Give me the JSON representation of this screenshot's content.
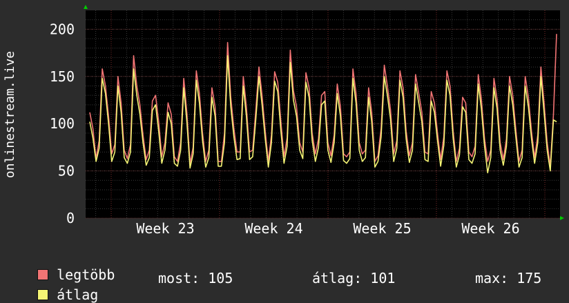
{
  "chart_data": {
    "type": "line",
    "ylabel": "onlinestream.live",
    "ylim": [
      0,
      220
    ],
    "yticks": [
      0,
      50,
      100,
      150,
      200
    ],
    "ytick_labels": [
      "0",
      "50",
      "100",
      "150",
      "200"
    ],
    "xticks": [
      "Week 23",
      "Week 24",
      "Week 25",
      "Week 26"
    ],
    "grid": true,
    "series": [
      {
        "name": "legtöbb",
        "color": "#f27474",
        "values": [
          112,
          95,
          63,
          82,
          158,
          140,
          108,
          68,
          78,
          150,
          122,
          72,
          63,
          78,
          172,
          140,
          120,
          88,
          62,
          72,
          124,
          130,
          102,
          65,
          80,
          122,
          110,
          65,
          60,
          80,
          148,
          112,
          58,
          75,
          156,
          132,
          90,
          60,
          72,
          138,
          118,
          60,
          60,
          90,
          186,
          128,
          95,
          70,
          70,
          150,
          118,
          70,
          72,
          115,
          160,
          130,
          92,
          60,
          88,
          155,
          144,
          102,
          65,
          85,
          178,
          135,
          118,
          80,
          70,
          154,
          138,
          90,
          68,
          84,
          130,
          134,
          80,
          66,
          88,
          142,
          118,
          68,
          65,
          70,
          158,
          132,
          80,
          68,
          72,
          138,
          112,
          60,
          66,
          95,
          162,
          140,
          115,
          68,
          82,
          156,
          138,
          92,
          66,
          80,
          152,
          132,
          112,
          70,
          68,
          134,
          122,
          90,
          62,
          86,
          156,
          140,
          92,
          60,
          74,
          128,
          122,
          70,
          65,
          76,
          152,
          126,
          84,
          60,
          72,
          148,
          126,
          80,
          62,
          84,
          150,
          130,
          94,
          60,
          72,
          150,
          128,
          92,
          64,
          88,
          160,
          122,
          80,
          55,
          110,
          195
        ]
      },
      {
        "name": "átlag",
        "color": "#f4f474",
        "values": [
          102,
          85,
          60,
          74,
          148,
          132,
          100,
          60,
          70,
          140,
          112,
          64,
          58,
          70,
          158,
          130,
          110,
          80,
          56,
          64,
          114,
          120,
          92,
          58,
          72,
          112,
          100,
          58,
          55,
          72,
          138,
          102,
          53,
          68,
          146,
          122,
          82,
          54,
          64,
          128,
          108,
          55,
          55,
          80,
          172,
          118,
          86,
          62,
          63,
          140,
          108,
          62,
          65,
          105,
          150,
          120,
          84,
          54,
          80,
          145,
          134,
          92,
          58,
          76,
          165,
          125,
          108,
          72,
          63,
          144,
          128,
          82,
          60,
          75,
          120,
          124,
          72,
          59,
          80,
          132,
          108,
          61,
          58,
          63,
          148,
          122,
          72,
          60,
          64,
          128,
          102,
          54,
          60,
          86,
          150,
          130,
          105,
          60,
          74,
          146,
          128,
          84,
          59,
          72,
          142,
          122,
          102,
          62,
          60,
          124,
          112,
          82,
          55,
          77,
          146,
          130,
          84,
          54,
          67,
          118,
          112,
          62,
          58,
          68,
          142,
          116,
          76,
          48,
          64,
          138,
          116,
          72,
          56,
          76,
          140,
          120,
          86,
          54,
          64,
          140,
          118,
          84,
          58,
          80,
          150,
          112,
          72,
          50,
          104,
          102
        ]
      }
    ]
  },
  "legend": [
    {
      "label": "legtöbb",
      "color": "#f27474"
    },
    {
      "label": "átlag",
      "color": "#f4f474"
    }
  ],
  "stats": {
    "most": "most: 105",
    "atlag": "átlag: 101",
    "max": "max: 175"
  }
}
